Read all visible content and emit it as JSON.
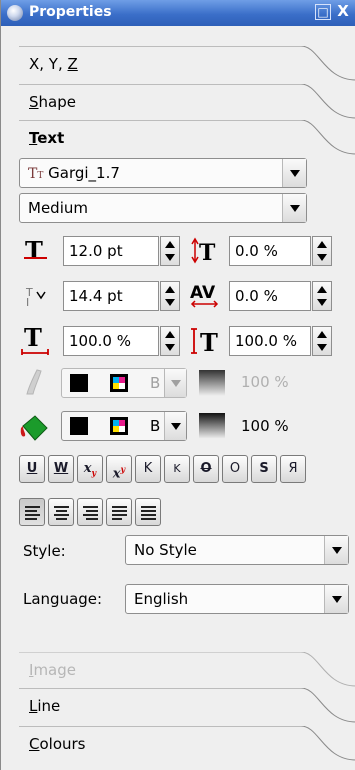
{
  "window": {
    "title": "Properties",
    "float_btn": "□",
    "close_btn": "X"
  },
  "tabs": {
    "xyz": "X, Y, Z",
    "shape": "Shape",
    "text": "Text",
    "image": "Image",
    "line": "Line",
    "colours": "Colours"
  },
  "text_panel": {
    "font_family": "Gargi_1.7",
    "font_style": "Medium",
    "font_size": "12.0 pt",
    "line_spacing": "14.4 pt",
    "tracking": "0.0 %",
    "baseline_offset": "0.0 %",
    "horiz_scale": "100.0 %",
    "vert_scale": "100.0 %",
    "stroke_shade": "100 %",
    "fill_shade": "100 %",
    "stroke_swatch_label": "B",
    "fill_swatch_label": "B",
    "effect_buttons": [
      "U",
      "W",
      "x",
      "x",
      "K",
      "K",
      "O",
      "O",
      "S",
      "Я"
    ],
    "style_label": "Style:",
    "style_value": "No Style",
    "language_label": "Language:",
    "language_value": "English"
  },
  "colors": {
    "title_bg": "#3b6fc9",
    "panel_bg": "#efefef",
    "text_red": "#cc0000"
  }
}
